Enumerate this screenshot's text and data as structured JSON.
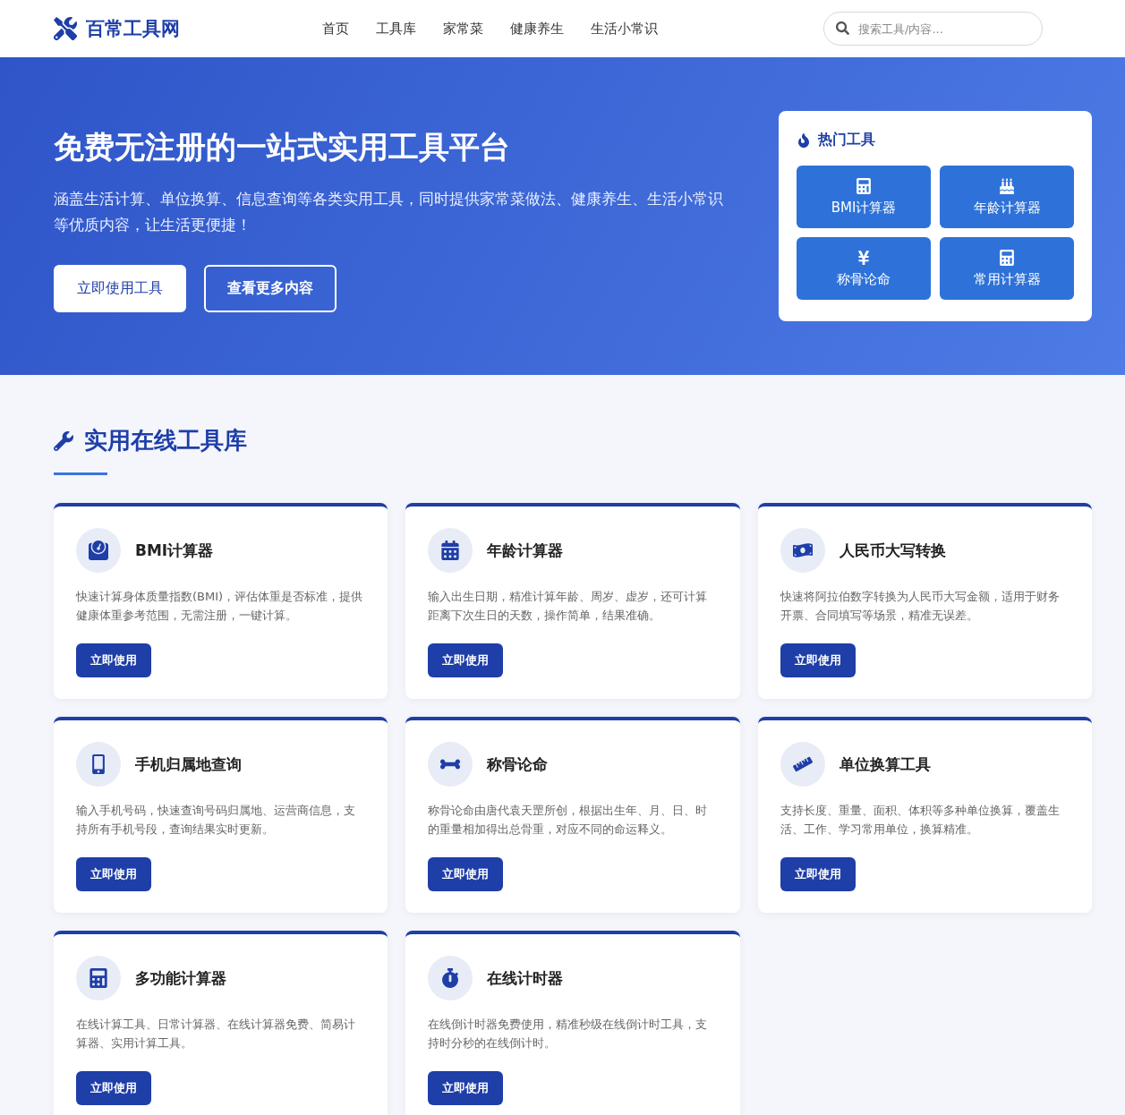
{
  "header": {
    "logo": "百常工具网",
    "nav": [
      {
        "label": "首页"
      },
      {
        "label": "工具库"
      },
      {
        "label": "家常菜"
      },
      {
        "label": "健康养生"
      },
      {
        "label": "生活小常识"
      }
    ],
    "search": {
      "placeholder": "搜索工具/内容..."
    }
  },
  "hero": {
    "title": "免费无注册的一站式实用工具平台",
    "subtitle": "涵盖生活计算、单位换算、信息查询等各类实用工具，同时提供家常菜做法、健康养生、生活小常识等优质内容，让生活更便捷！",
    "buttons": [
      {
        "label": "立即使用工具",
        "kind": "solid"
      },
      {
        "label": "查看更多内容",
        "kind": "outline"
      }
    ]
  },
  "hot_tools": {
    "title": "热门工具",
    "items": [
      {
        "label": "BMI计算器"
      },
      {
        "label": "年龄计算器"
      },
      {
        "label": "称骨论命"
      },
      {
        "label": "常用计算器"
      }
    ]
  },
  "section": {
    "title": "实用在线工具库",
    "cards": [
      {
        "title": "BMI计算器",
        "description": "快速计算身体质量指数(BMI)，评估体重是否标准，提供健康体重参考范围，无需注册，一键计算。",
        "button": "立即使用"
      },
      {
        "title": "年龄计算器",
        "description": "输入出生日期，精准计算年龄、周岁、虚岁，还可计算距离下次生日的天数，操作简单，结果准确。",
        "button": "立即使用"
      },
      {
        "title": "人民币大写转换",
        "description": "快速将阿拉伯数字转换为人民币大写金额，适用于财务开票、合同填写等场景，精准无误差。",
        "button": "立即使用"
      },
      {
        "title": "手机归属地查询",
        "description": "输入手机号码，快速查询号码归属地、运营商信息，支持所有手机号段，查询结果实时更新。",
        "button": "立即使用"
      },
      {
        "title": "称骨论命",
        "description": "称骨论命由唐代袁天罡所创，根据出生年、月、日、时的重量相加得出总骨重，对应不同的命运释义。",
        "button": "立即使用"
      },
      {
        "title": "单位换算工具",
        "description": "支持长度、重量、面积、体积等多种单位换算，覆盖生活、工作、学习常用单位，换算精准。",
        "button": "立即使用"
      },
      {
        "title": "多功能计算器",
        "description": "在线计算工具、日常计算器、在线计算器免费、简易计算器、实用计算工具。",
        "button": "立即使用"
      },
      {
        "title": "在线计时器",
        "description": "在线倒计时器免费使用，精准秒级在线倒计时工具，支持时分秒的在线倒计时。",
        "button": "立即使用"
      }
    ]
  }
}
